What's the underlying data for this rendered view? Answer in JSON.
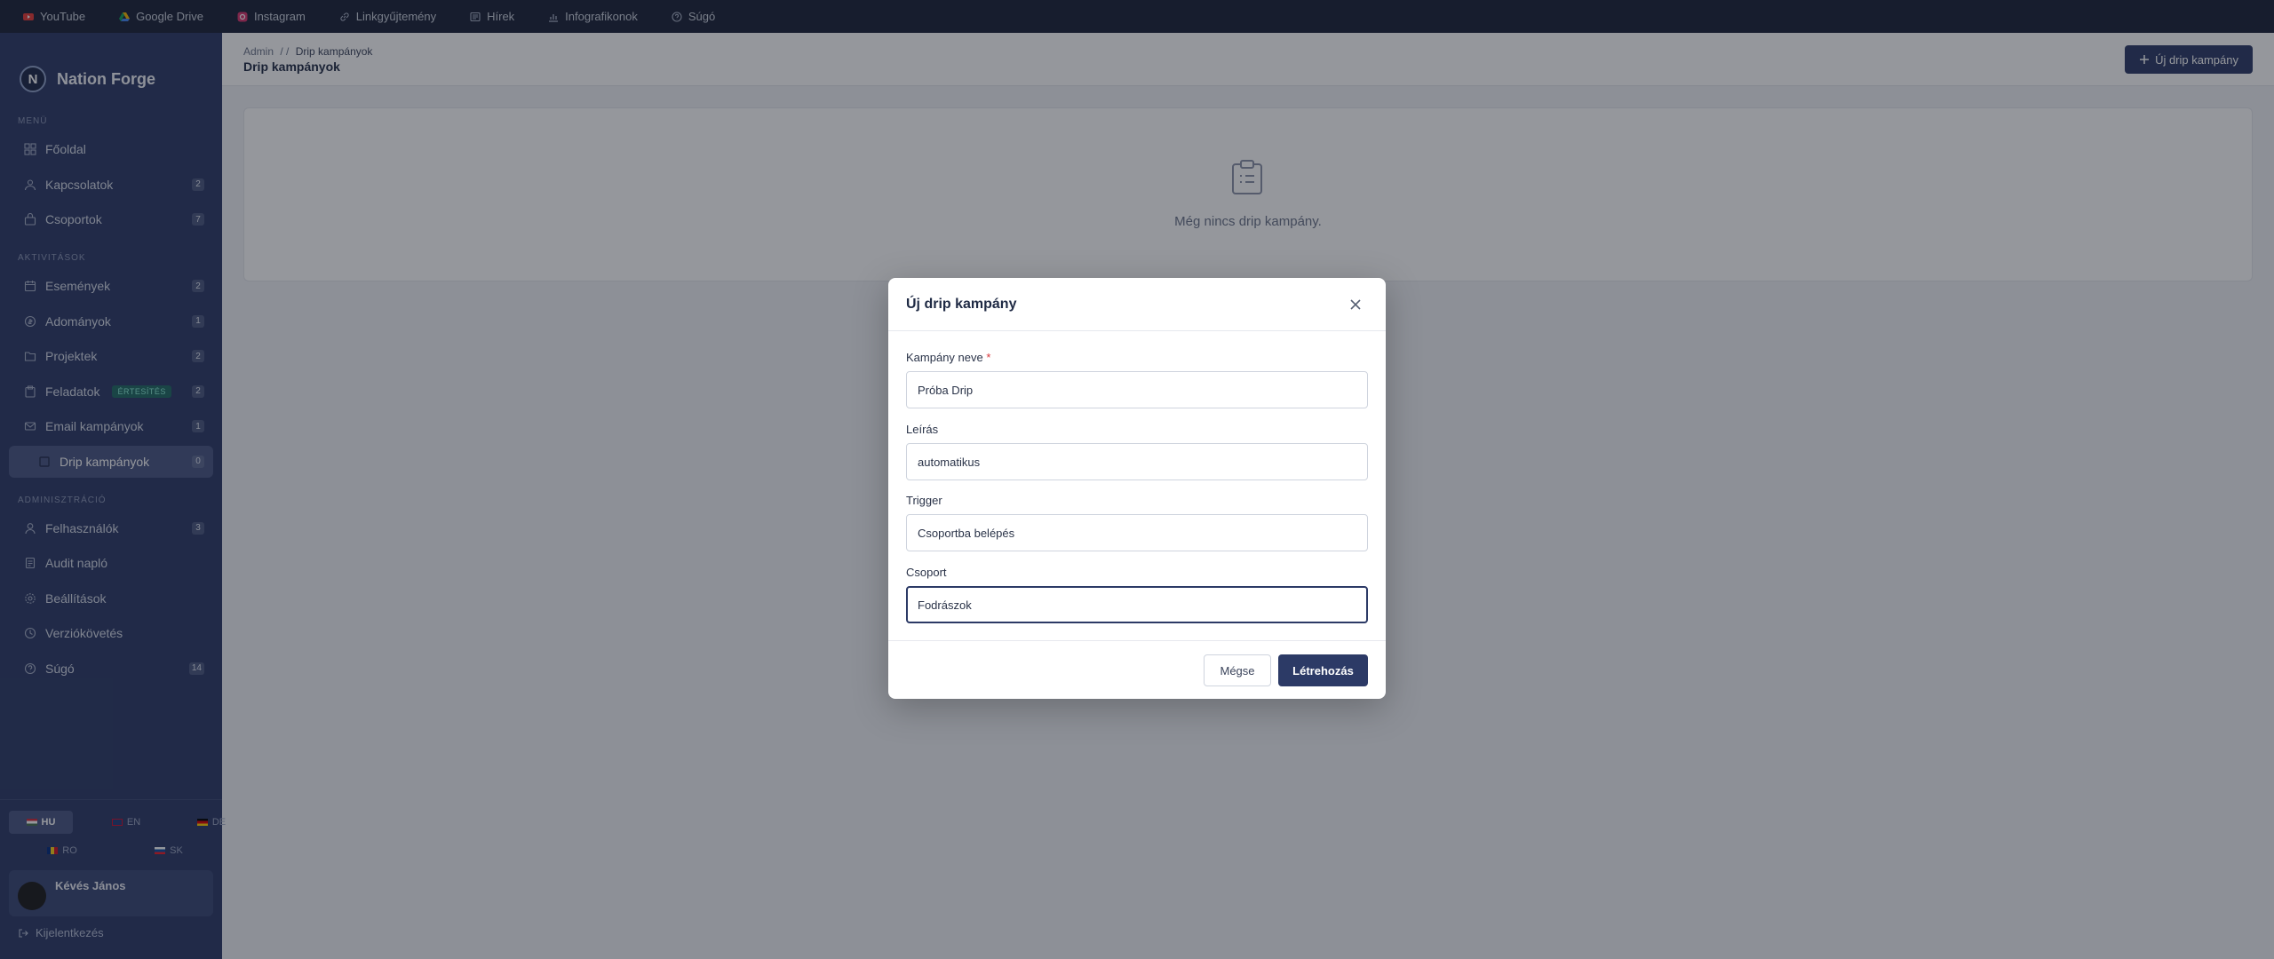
{
  "bookmarks": [
    {
      "label": "YouTube",
      "icon": "youtube-icon",
      "color": "#e53935"
    },
    {
      "label": "Google Drive",
      "icon": "google-drive-icon",
      "color": "#f4b400"
    },
    {
      "label": "Instagram",
      "icon": "instagram-icon",
      "color": "#d6336c"
    },
    {
      "label": "Linkgyűjtemény",
      "icon": "link-icon",
      "color": "#aab3c7"
    },
    {
      "label": "Hírek",
      "icon": "news-icon",
      "color": "#aab3c7"
    },
    {
      "label": "Infografikonok",
      "icon": "chart-icon",
      "color": "#aab3c7"
    },
    {
      "label": "Súgó",
      "icon": "help-icon",
      "color": "#aab3c7"
    }
  ],
  "sidebar": {
    "brand_letter": "N",
    "brand_name": "Nation Forge",
    "sections": [
      {
        "title": "MENÜ",
        "items": [
          {
            "label": "Főoldal",
            "icon": "dashboard-icon",
            "count": ""
          },
          {
            "label": "Kapcsolatok",
            "icon": "contacts-icon",
            "count": "2"
          },
          {
            "label": "Csoportok",
            "icon": "groups-icon",
            "count": "7"
          }
        ]
      },
      {
        "title": "AKTIVITÁSOK",
        "items": [
          {
            "label": "Események",
            "icon": "calendar-icon",
            "count": "2"
          },
          {
            "label": "Adományok",
            "icon": "donation-icon",
            "count": "1"
          },
          {
            "label": "Projektek",
            "icon": "folder-icon",
            "count": "2"
          },
          {
            "label": "Feladatok",
            "icon": "clipboard-icon",
            "count": "2",
            "badge": "ÉRTESÍTÉS"
          },
          {
            "label": "Email kampányok",
            "icon": "mail-icon",
            "count": "1"
          },
          {
            "label": "Drip kampányok",
            "icon": "drip-icon",
            "count": "0",
            "active": true
          }
        ]
      },
      {
        "title": "ADMINISZTRÁCIÓ",
        "items": [
          {
            "label": "Felhasználók",
            "icon": "user-icon",
            "count": "3"
          },
          {
            "label": "Audit napló",
            "icon": "audit-icon",
            "count": ""
          },
          {
            "label": "Beállítások",
            "icon": "settings-icon",
            "count": ""
          },
          {
            "label": "Verziókövetés",
            "icon": "history-icon",
            "count": ""
          },
          {
            "label": "Súgó",
            "icon": "help-icon",
            "count": "14"
          }
        ]
      }
    ],
    "languages": [
      {
        "code": "HU",
        "active": true
      },
      {
        "code": "EN"
      },
      {
        "code": "DE"
      },
      {
        "code": "RO"
      },
      {
        "code": "SK"
      }
    ],
    "user_name": "Kévés János",
    "logout_label": "Kijelentkezés"
  },
  "header": {
    "breadcrumb_root": "Admin",
    "breadcrumb_sep": "/ /",
    "breadcrumb_current": "Drip kampányok",
    "title": "Drip kampányok",
    "new_button": "Új drip kampány"
  },
  "empty_state": {
    "text": "Még nincs drip kampány."
  },
  "modal": {
    "title": "Új drip kampány",
    "fields": [
      {
        "label": "Kampány neve",
        "required": "*",
        "value": "Próba Drip"
      },
      {
        "label": "Leírás",
        "value": "automatikus"
      },
      {
        "label": "Trigger",
        "value": "Csoportba belépés"
      },
      {
        "label": "Csoport",
        "value": "Fodrászok"
      }
    ],
    "cancel": "Mégse",
    "submit": "Létrehozás"
  }
}
